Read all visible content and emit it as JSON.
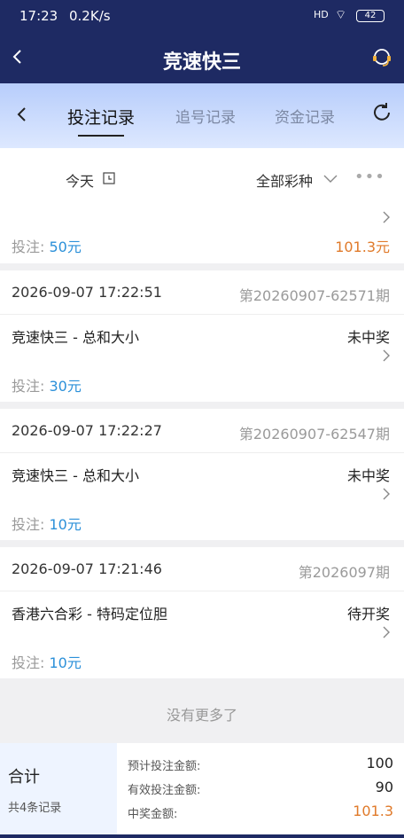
{
  "status_bar": {
    "time": "17:23",
    "network_speed": "0.2K/s",
    "signal": "HD",
    "battery": "42"
  },
  "header": {
    "title": "竞速快三"
  },
  "tabs": [
    {
      "label": "投注记录",
      "active": true
    },
    {
      "label": "追号记录",
      "active": false
    },
    {
      "label": "资金记录",
      "active": false
    }
  ],
  "filter": {
    "date": "今天",
    "lottery": "全部彩种",
    "more": "•••"
  },
  "partial_record": {
    "bet_label": "投注:",
    "bet_amount": "50元",
    "win_amount": "101.3元"
  },
  "records": [
    {
      "datetime": "2026-09-07 17:22:51",
      "issue": "第20260907-62571期",
      "game": "竞速快三 - 总和大小",
      "status": "未中奖",
      "bet_label": "投注:",
      "bet_amount": "30元"
    },
    {
      "datetime": "2026-09-07 17:22:27",
      "issue": "第20260907-62547期",
      "game": "竞速快三 - 总和大小",
      "status": "未中奖",
      "bet_label": "投注:",
      "bet_amount": "10元"
    },
    {
      "datetime": "2026-09-07 17:21:46",
      "issue": "第2026097期",
      "game": "香港六合彩 - 特码定位胆",
      "status": "待开奖",
      "bet_label": "投注:",
      "bet_amount": "10元"
    }
  ],
  "no_more": "没有更多了",
  "summary": {
    "heading": "合计",
    "record_count": "共4条记录",
    "expected_bet_label": "预计投注金额:",
    "expected_bet_value": "100",
    "valid_bet_label": "有效投注金额:",
    "valid_bet_value": "90",
    "win_label": "中奖金额:",
    "win_value": "101.3"
  },
  "colors": {
    "header_bg": "#1e2a63",
    "accent_blue": "#2b90d9",
    "accent_orange": "#e07a2a"
  }
}
